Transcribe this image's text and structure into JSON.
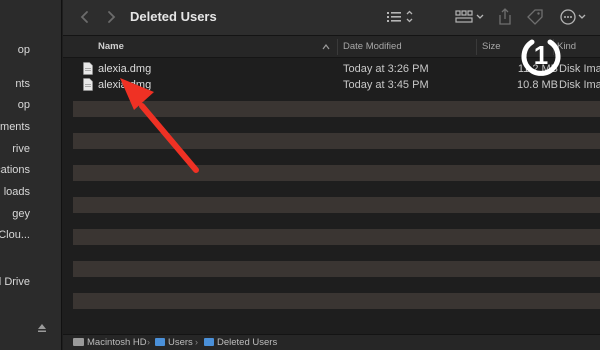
{
  "window": {
    "title": "Deleted Users"
  },
  "sidebar": {
    "items": [
      {
        "label": "op",
        "id": "sidebar-item-desktop"
      },
      {
        "label": "nts",
        "id": "sidebar-item-recents"
      },
      {
        "label": "op",
        "id": "sidebar-item-desktop-2"
      },
      {
        "label": "ments",
        "id": "sidebar-item-documents"
      },
      {
        "label": "rive",
        "id": "sidebar-item-drive"
      },
      {
        "label": "cations",
        "id": "sidebar-item-applications"
      },
      {
        "label": "loads",
        "id": "sidebar-item-downloads"
      },
      {
        "label": "gey",
        "id": "sidebar-item-user"
      },
      {
        "label": "ive Clou...",
        "id": "sidebar-item-icloud-drive"
      },
      {
        "label": "",
        "id": "sidebar-item-blank"
      },
      {
        "label": "d Drive",
        "id": "sidebar-item-icloud-drive-2"
      }
    ]
  },
  "columns": {
    "name": "Name",
    "date": "Date Modified",
    "size": "Size",
    "kind": "Kind"
  },
  "files": [
    {
      "name": "alexia.dmg",
      "date": "Today at 3:26 PM",
      "size": "11.2 MB",
      "kind": "Disk Image"
    },
    {
      "name": "alexia.dmg",
      "date": "Today at 3:45 PM",
      "size": "10.8 MB",
      "kind": "Disk Image"
    }
  ],
  "pathbar": {
    "drive": "Macintosh HD",
    "folder1": "Users",
    "folder2": "Deleted Users",
    "sep": "›"
  },
  "overlay": {
    "logo_text": "1"
  },
  "colors": {
    "accent": "#4a90d9",
    "arrow": "#ef3124",
    "stripe": "#3a3532"
  }
}
